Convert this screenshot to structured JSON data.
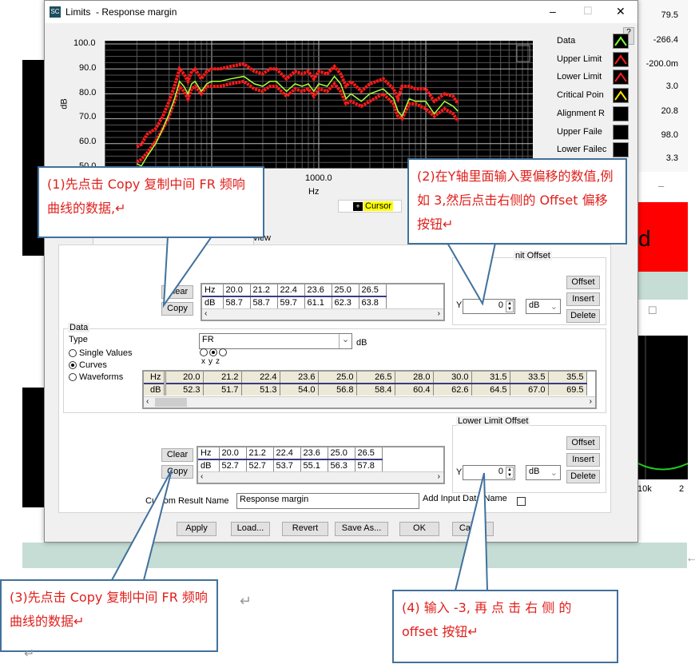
{
  "window": {
    "title": "Limits  - Response margin",
    "app_icon": "SC",
    "minimize": "–",
    "maximize": "☐",
    "close": "✕",
    "help": "?"
  },
  "background": {
    "right_values": [
      "79.5",
      "-266.4",
      "-200.0m",
      "3.0",
      "20.8",
      "98.0",
      "3.3"
    ],
    "red_panel_text": "d",
    "chart_tick": "10k",
    "chart_tick2": "2",
    "minimize": "–",
    "maximize": "☐"
  },
  "plot": {
    "ylabel": "dB",
    "xlabel": "Hz",
    "yticks": [
      "100.0",
      "90.0",
      "80.0",
      "70.0",
      "60.0",
      "50.0"
    ],
    "xticks": [
      "1000.0"
    ],
    "cursor_label": "Cursor",
    "legend": [
      {
        "label": "Data",
        "color": "#7dff3a"
      },
      {
        "label": "Upper Limit",
        "color": "#ff1a1a"
      },
      {
        "label": "Lower Limit",
        "color": "#ff1a1a"
      },
      {
        "label": "Critical Poin",
        "color": "#ffe600"
      },
      {
        "label": "Alignment R",
        "color": ""
      },
      {
        "label": "Upper Faile",
        "color": ""
      },
      {
        "label": "Lower Failec",
        "color": ""
      }
    ]
  },
  "chart_data": {
    "type": "line",
    "xscale": "log",
    "xlim": [
      10,
      100000
    ],
    "ylim": [
      50,
      100
    ],
    "xlabel": "Hz",
    "ylabel": "dB",
    "grid": true,
    "x": [
      20,
      22,
      25,
      30,
      35,
      40,
      45,
      50,
      55,
      60,
      65,
      70,
      80,
      90,
      100,
      120,
      150,
      200,
      250,
      300,
      350,
      400,
      500,
      600,
      700,
      800,
      900,
      1000,
      1200,
      1400,
      1600,
      1800,
      2000,
      2500,
      3000,
      4000,
      5000,
      5500,
      6000,
      7000,
      8000,
      10000,
      12000,
      15000,
      18000,
      20000
    ],
    "series": [
      {
        "name": "Data",
        "color": "#a8ff3a",
        "values": [
          52,
          51,
          55,
          60,
          66,
          72,
          78,
          85,
          83,
          80,
          84,
          85,
          81,
          84,
          85,
          85,
          86,
          87,
          84,
          83,
          85,
          85,
          81,
          84,
          83,
          84,
          81,
          84,
          83,
          87,
          84,
          78,
          80,
          77,
          80,
          82,
          78,
          73,
          71,
          78,
          77,
          77,
          72,
          77,
          75,
          73
        ]
      },
      {
        "name": "Upper Limit",
        "color": "#ff1a1a",
        "values": [
          58.7,
          59.7,
          63.8,
          66,
          71,
          77,
          83,
          90,
          88,
          85,
          89,
          90,
          86,
          89,
          90,
          90,
          91,
          92,
          89,
          88,
          90,
          90,
          86,
          89,
          88,
          89,
          86,
          89,
          88,
          91,
          88,
          83,
          85,
          81,
          84,
          86,
          82,
          78,
          83,
          83,
          82,
          82,
          77,
          80,
          79,
          76
        ]
      },
      {
        "name": "Lower Limit",
        "color": "#ff1a1a",
        "values": [
          52.7,
          53.7,
          56.3,
          61,
          66,
          71,
          77,
          83,
          81,
          78,
          82,
          83,
          80,
          83,
          83,
          83,
          84,
          85,
          82,
          81,
          83,
          83,
          79,
          82,
          81,
          82,
          79,
          82,
          81,
          84,
          81,
          76,
          77,
          75,
          77,
          80,
          76,
          71,
          70,
          76,
          76,
          74,
          71,
          74,
          72,
          69
        ]
      }
    ]
  },
  "tabs": {
    "partial_label": "view"
  },
  "upper_offset": {
    "group_title": "nit Offset",
    "y_label": "Y",
    "y_value": "0",
    "unit": "dB",
    "offset": "Offset",
    "insert": "Insert",
    "delete": "Delete"
  },
  "upper_table": {
    "clear": "Clear",
    "copy": "Copy",
    "hz": "Hz",
    "db": "dB",
    "x": [
      "20.0",
      "21.2",
      "22.4",
      "23.6",
      "25.0",
      "26.5"
    ],
    "y": [
      "58.7",
      "58.7",
      "59.7",
      "61.1",
      "62.3",
      "63.8"
    ]
  },
  "data_group": {
    "title": "Data",
    "type_label": "Type",
    "type_value": "FR",
    "type_unit": "dB",
    "modes": [
      "Single Values",
      "Curves",
      "Waveforms"
    ],
    "selected_mode": "Curves",
    "axes": [
      "x",
      "y",
      "z"
    ],
    "selected_axis": "y",
    "hz": "Hz",
    "db": "dB",
    "x": [
      "20.0",
      "21.2",
      "22.4",
      "23.6",
      "25.0",
      "26.5",
      "28.0",
      "30.0",
      "31.5",
      "33.5",
      "35.5"
    ],
    "y": [
      "52.3",
      "51.7",
      "51.3",
      "54.0",
      "56.8",
      "58.4",
      "60.4",
      "62.6",
      "64.5",
      "67.0",
      "69.5"
    ]
  },
  "lower_offset": {
    "group_title": "Lower Limit Offset",
    "y_label": "Y",
    "y_value": "0",
    "unit": "dB",
    "offset": "Offset",
    "insert": "Insert",
    "delete": "Delete"
  },
  "lower_table": {
    "clear": "Clear",
    "copy": "Copy",
    "hz": "Hz",
    "db": "dB",
    "x": [
      "20.0",
      "21.2",
      "22.4",
      "23.6",
      "25.0",
      "26.5"
    ],
    "y": [
      "52.7",
      "52.7",
      "53.7",
      "55.1",
      "56.3",
      "57.8"
    ]
  },
  "result": {
    "label": "Custom Result Name",
    "value": "Response margin",
    "add_input_label": "Add Input Data Name"
  },
  "footer": {
    "apply": "Apply",
    "load": "Load...",
    "revert": "Revert",
    "save_as": "Save As...",
    "ok": "OK",
    "cancel": "Cancel"
  },
  "callouts": [
    {
      "text": "(1)先点击 Copy 复制中间 FR 频响曲线的数据,↵"
    },
    {
      "text": "(2)在Y轴里面输入要偏移的数值,例如  3,然后点击右侧的 Offset 偏移按钮↵"
    },
    {
      "text": "(3)先点击 Copy 复制中间 FR 频响曲线的数据↵"
    },
    {
      "text": "(4) 输入 -3, 再 点 击 右 侧 的 offset 按钮↵"
    }
  ],
  "marks": [
    "↵",
    "↵",
    "↵",
    "←"
  ]
}
